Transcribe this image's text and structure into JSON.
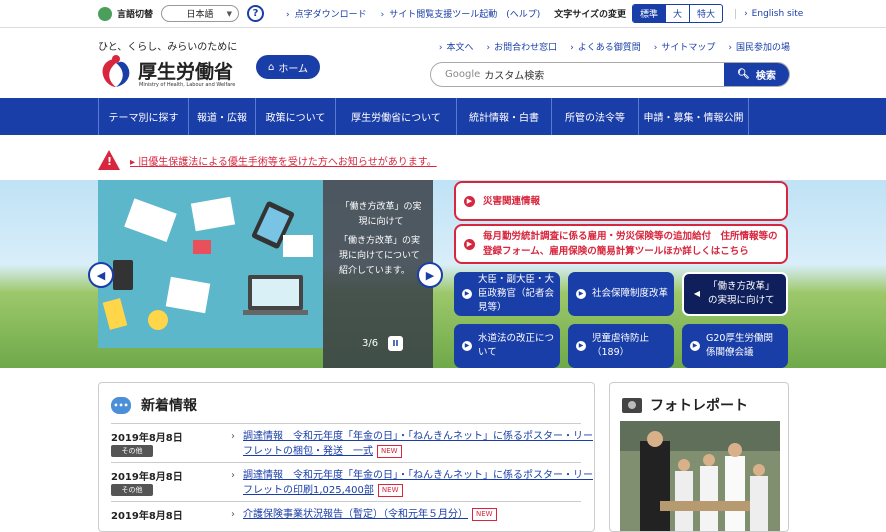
{
  "util": {
    "lang_label": "言語切替",
    "lang_value": "日本語",
    "help": "?",
    "links": [
      "点字ダウンロード",
      "サイト閲覧支援ツール起動　(ヘルプ)"
    ],
    "fontsize_label": "文字サイズの変更",
    "fontsizes": [
      "標準",
      "大",
      "特大"
    ],
    "english": "English site"
  },
  "header": {
    "tagline": "ひと、くらし、みらいのために",
    "logo_name": "厚生労働省",
    "logo_en": "Ministry of Health, Labour and Welfare",
    "home": "ホーム",
    "links": [
      "本文へ",
      "お問合わせ窓口",
      "よくある御質問",
      "サイトマップ",
      "国民参加の場"
    ],
    "search_placeholder_prefix": "Google",
    "search_placeholder": "カスタム検索",
    "search_button": "検索"
  },
  "nav": [
    "テーマ別に探す",
    "報道・広報",
    "政策について",
    "厚生労働省について",
    "統計情報・白書",
    "所管の法令等",
    "申請・募集・情報公開"
  ],
  "alert": {
    "text": "旧優生保護法による優生手術等を受けた方へお知らせがあります。"
  },
  "slider": {
    "panel_title": "「働き方改革」の実現に向けて",
    "panel_body": "「働き方改革」の実現に向けてについて紹介しています。",
    "counter": "3/6",
    "pause": "II"
  },
  "red_buttons": [
    "災害関連情報",
    "毎月勤労統計調査に係る雇用・労災保険等の追加給付　住所情報等の登録フォーム、雇用保険の簡易計算ツールほか詳しくはこちら"
  ],
  "tiles": [
    "大臣・副大臣・大臣政務官（記者会見等）",
    "社会保障制度改革",
    "「働き方改革」の実現に向けて",
    "水道法の改正について",
    "児童虐待防止（189）",
    "G20厚生労働関係閣僚会議"
  ],
  "news": {
    "title": "新着情報",
    "items": [
      {
        "date": "2019年8月8日",
        "cat": "その他",
        "text": "調達情報　令和元年度「年金の日」・「ねんきんネット」に係るポスター・リーフレットの梱包・発送　一式"
      },
      {
        "date": "2019年8月8日",
        "cat": "その他",
        "text": "調達情報　令和元年度「年金の日」・「ねんきんネット」に係るポスター・リーフレットの印刷1,025,400部"
      },
      {
        "date": "2019年8月8日",
        "cat": "",
        "text": "介護保険事業状況報告（暫定）（令和元年５月分）"
      }
    ],
    "new_badge": "NEW"
  },
  "photo": {
    "title": "フォトレポート"
  }
}
